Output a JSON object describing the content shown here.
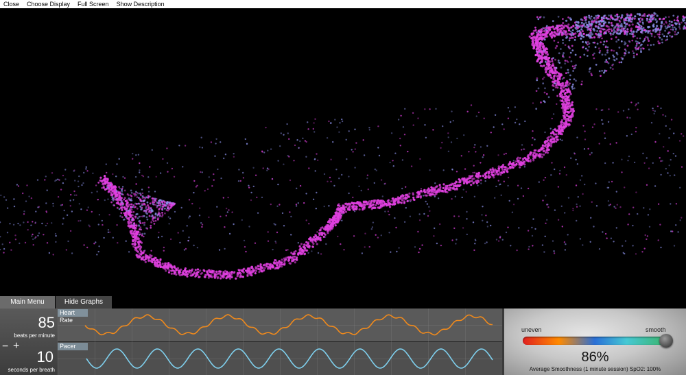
{
  "menu": {
    "close": "Close",
    "choose_display": "Choose Display",
    "full_screen": "Full Screen",
    "show_description": "Show Description"
  },
  "tabs": {
    "main_menu": "Main Menu",
    "hide_graphs": "Hide Graphs"
  },
  "heart_rate": {
    "value": "85",
    "unit": "beats per minute",
    "graph_label": "Heart Rate"
  },
  "pacer": {
    "value": "10",
    "unit": "seconds per breath",
    "graph_label": "Pacer",
    "minus": "−",
    "plus": "+"
  },
  "smoothness": {
    "left_label": "uneven",
    "right_label": "smooth",
    "percent": "86%",
    "caption": "Average Smoothness (1 minute session) SpO2: 100%"
  },
  "colors": {
    "heart_rate_line": "#f08a1c",
    "pacer_line": "#7fd0ee",
    "particle_primary": "#e040e0",
    "particle_secondary": "#8a90e8"
  }
}
